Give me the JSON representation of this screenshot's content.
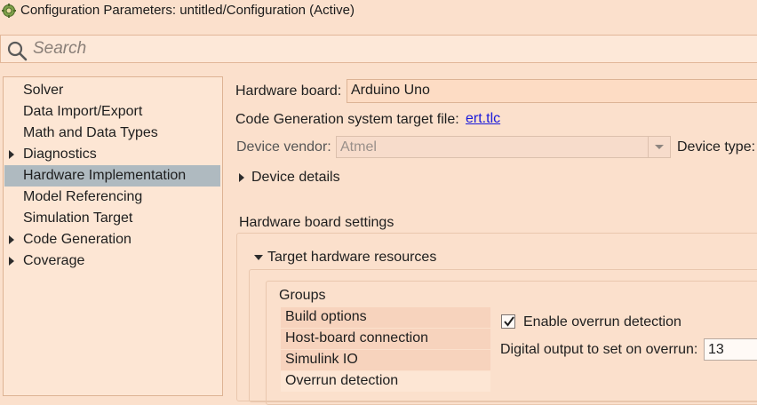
{
  "window": {
    "title": "Configuration Parameters: untitled/Configuration (Active)",
    "icon": "simulink-gear-icon"
  },
  "search": {
    "placeholder": "Search",
    "value": ""
  },
  "sidebar": {
    "items": [
      {
        "label": "Solver",
        "expandable": false,
        "selected": false
      },
      {
        "label": "Data Import/Export",
        "expandable": false,
        "selected": false
      },
      {
        "label": "Math and Data Types",
        "expandable": false,
        "selected": false
      },
      {
        "label": "Diagnostics",
        "expandable": true,
        "selected": false
      },
      {
        "label": "Hardware Implementation",
        "expandable": false,
        "selected": true
      },
      {
        "label": "Model Referencing",
        "expandable": false,
        "selected": false
      },
      {
        "label": "Simulation Target",
        "expandable": false,
        "selected": false
      },
      {
        "label": "Code Generation",
        "expandable": true,
        "selected": false
      },
      {
        "label": "Coverage",
        "expandable": true,
        "selected": false
      }
    ]
  },
  "main": {
    "hardware_board": {
      "label": "Hardware board:",
      "value": "Arduino Uno"
    },
    "target_file": {
      "label": "Code Generation system target file:",
      "link": "ert.tlc"
    },
    "device_vendor": {
      "label": "Device vendor:",
      "value": "Atmel"
    },
    "device_type": {
      "label": "Device type:"
    },
    "device_details": {
      "label": "Device details"
    },
    "board_settings": {
      "label": "Hardware board settings"
    },
    "target_resources": {
      "label": "Target hardware resources"
    },
    "groups": {
      "label": "Groups",
      "tabs": [
        {
          "label": "Build options",
          "selected": false
        },
        {
          "label": "Host-board connection",
          "selected": false
        },
        {
          "label": "Simulink IO",
          "selected": false
        },
        {
          "label": "Overrun detection",
          "selected": true
        }
      ]
    },
    "overrun": {
      "enable_label": "Enable overrun detection",
      "enabled": true,
      "pin_label": "Digital output to set on overrun:",
      "pin_value": "13"
    }
  },
  "colors": {
    "background": "#fbe0cc",
    "selection": "#afbac0",
    "link": "#1a1adb"
  }
}
